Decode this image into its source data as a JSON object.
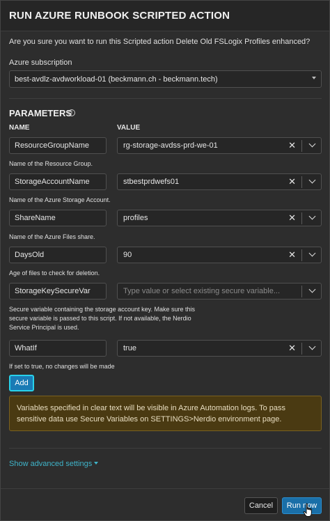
{
  "dialog": {
    "title": "RUN AZURE RUNBOOK SCRIPTED ACTION",
    "confirm_text": "Are you sure you want to run this Scripted action Delete Old FSLogix Profiles enhanced?"
  },
  "subscription": {
    "label": "Azure subscription",
    "value": "best-avdlz-avdworkload-01 (beckmann.ch - beckmann.tech)"
  },
  "parameters": {
    "title": "PARAMETERS",
    "info_icon": "info-circle-icon",
    "col_name": "NAME",
    "col_value": "VALUE",
    "rows": [
      {
        "name": "ResourceGroupName",
        "value": "rg-storage-avdss-prd-we-01",
        "desc": "Name of the Resource Group."
      },
      {
        "name": "StorageAccountName",
        "value": "stbestprdwefs01",
        "desc": "Name of the Azure Storage Account."
      },
      {
        "name": "ShareName",
        "value": "profiles",
        "desc": "Name of the Azure Files share."
      },
      {
        "name": "DaysOld",
        "value": "90",
        "desc": "Age of files to check for deletion."
      },
      {
        "name": "StorageKeySecureVar",
        "placeholder": "Type value or select existing secure variable...",
        "desc": "Secure variable containing the storage account key. Make sure this secure variable is passed to this script. If not available, the Nerdio Service Principal is used."
      },
      {
        "name": "WhatIf",
        "value": "true",
        "desc": "If set to true, no changes will be made"
      }
    ],
    "add_label": "Add"
  },
  "warning": {
    "text": "Variables specified in clear text will be visible in Azure Automation logs. To pass sensitive data use Secure Variables on SETTINGS>Nerdio environment page.",
    "bg_color": "#4a3a12"
  },
  "advanced": {
    "label": "Show advanced settings"
  },
  "footer": {
    "cancel_label": "Cancel",
    "run_label": "Run now"
  },
  "colors": {
    "accent": "#1a7bb5",
    "link": "#3fb4c9",
    "background": "#2d2d2d"
  }
}
